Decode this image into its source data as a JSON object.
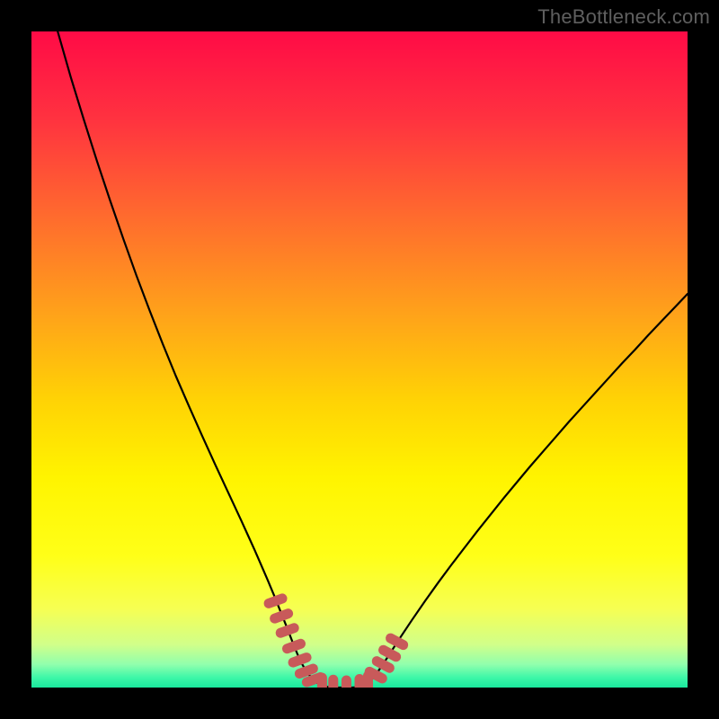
{
  "watermark": "TheBottleneck.com",
  "chart_data": {
    "type": "line",
    "title": "",
    "xlabel": "",
    "ylabel": "",
    "xlim": [
      0,
      100
    ],
    "ylim": [
      0,
      100
    ],
    "grid": false,
    "legend": false,
    "series": [
      {
        "name": "left-curve",
        "x": [
          4,
          6,
          8,
          10,
          12,
          14,
          16,
          18,
          20,
          22,
          24,
          26,
          28,
          30,
          32,
          33,
          34,
          35,
          36,
          37,
          38,
          39,
          40,
          41,
          42,
          43,
          44,
          45
        ],
        "y": [
          100,
          93,
          86.5,
          80.2,
          74.2,
          68.4,
          62.8,
          57.5,
          52.4,
          47.5,
          42.9,
          38.4,
          34.0,
          29.7,
          25.4,
          23.2,
          21.0,
          18.7,
          16.4,
          14.0,
          11.5,
          9.0,
          6.4,
          4.0,
          2.3,
          1.1,
          0.4,
          0.1
        ]
      },
      {
        "name": "right-curve",
        "x": [
          50,
          51,
          52,
          53,
          54,
          56,
          58,
          60,
          62,
          64,
          66,
          68,
          70,
          72,
          74,
          76,
          78,
          80,
          82,
          84,
          86,
          88,
          90,
          92,
          94,
          96,
          98,
          100
        ],
        "y": [
          0.1,
          0.5,
          1.4,
          2.7,
          4.2,
          7.3,
          10.3,
          13.2,
          16.0,
          18.7,
          21.3,
          23.9,
          26.4,
          28.9,
          31.3,
          33.7,
          36.0,
          38.3,
          40.6,
          42.8,
          45.0,
          47.2,
          49.4,
          51.5,
          53.7,
          55.8,
          57.9,
          60.0
        ]
      },
      {
        "name": "bottom-flat",
        "x": [
          45,
          46,
          47,
          48,
          49,
          50
        ],
        "y": [
          0.1,
          0.0,
          0.0,
          0.0,
          0.0,
          0.1
        ]
      }
    ],
    "markers": {
      "name": "highlight-markers",
      "color": "#c85a5a",
      "points": [
        {
          "x": 37.2,
          "y": 13.2
        },
        {
          "x": 38.1,
          "y": 10.9
        },
        {
          "x": 39.0,
          "y": 8.7
        },
        {
          "x": 40.0,
          "y": 6.3
        },
        {
          "x": 40.9,
          "y": 4.2
        },
        {
          "x": 41.9,
          "y": 2.5
        },
        {
          "x": 43.0,
          "y": 1.2
        },
        {
          "x": 44.3,
          "y": 0.4
        },
        {
          "x": 46.0,
          "y": 0.1
        },
        {
          "x": 48.0,
          "y": 0.0
        },
        {
          "x": 50.0,
          "y": 0.2
        },
        {
          "x": 51.3,
          "y": 0.7
        },
        {
          "x": 52.5,
          "y": 1.9
        },
        {
          "x": 53.6,
          "y": 3.5
        },
        {
          "x": 54.6,
          "y": 5.2
        },
        {
          "x": 55.7,
          "y": 7.0
        }
      ]
    },
    "gradient": {
      "stops": [
        {
          "offset": 0.0,
          "color": "#ff0b46"
        },
        {
          "offset": 0.13,
          "color": "#ff3140"
        },
        {
          "offset": 0.28,
          "color": "#ff6a2e"
        },
        {
          "offset": 0.43,
          "color": "#ffa21a"
        },
        {
          "offset": 0.56,
          "color": "#ffd205"
        },
        {
          "offset": 0.68,
          "color": "#fff400"
        },
        {
          "offset": 0.8,
          "color": "#ffff18"
        },
        {
          "offset": 0.88,
          "color": "#f6ff53"
        },
        {
          "offset": 0.935,
          "color": "#d0ff8a"
        },
        {
          "offset": 0.965,
          "color": "#90ffad"
        },
        {
          "offset": 0.985,
          "color": "#3cf7a8"
        },
        {
          "offset": 1.0,
          "color": "#1ae79c"
        }
      ]
    }
  }
}
